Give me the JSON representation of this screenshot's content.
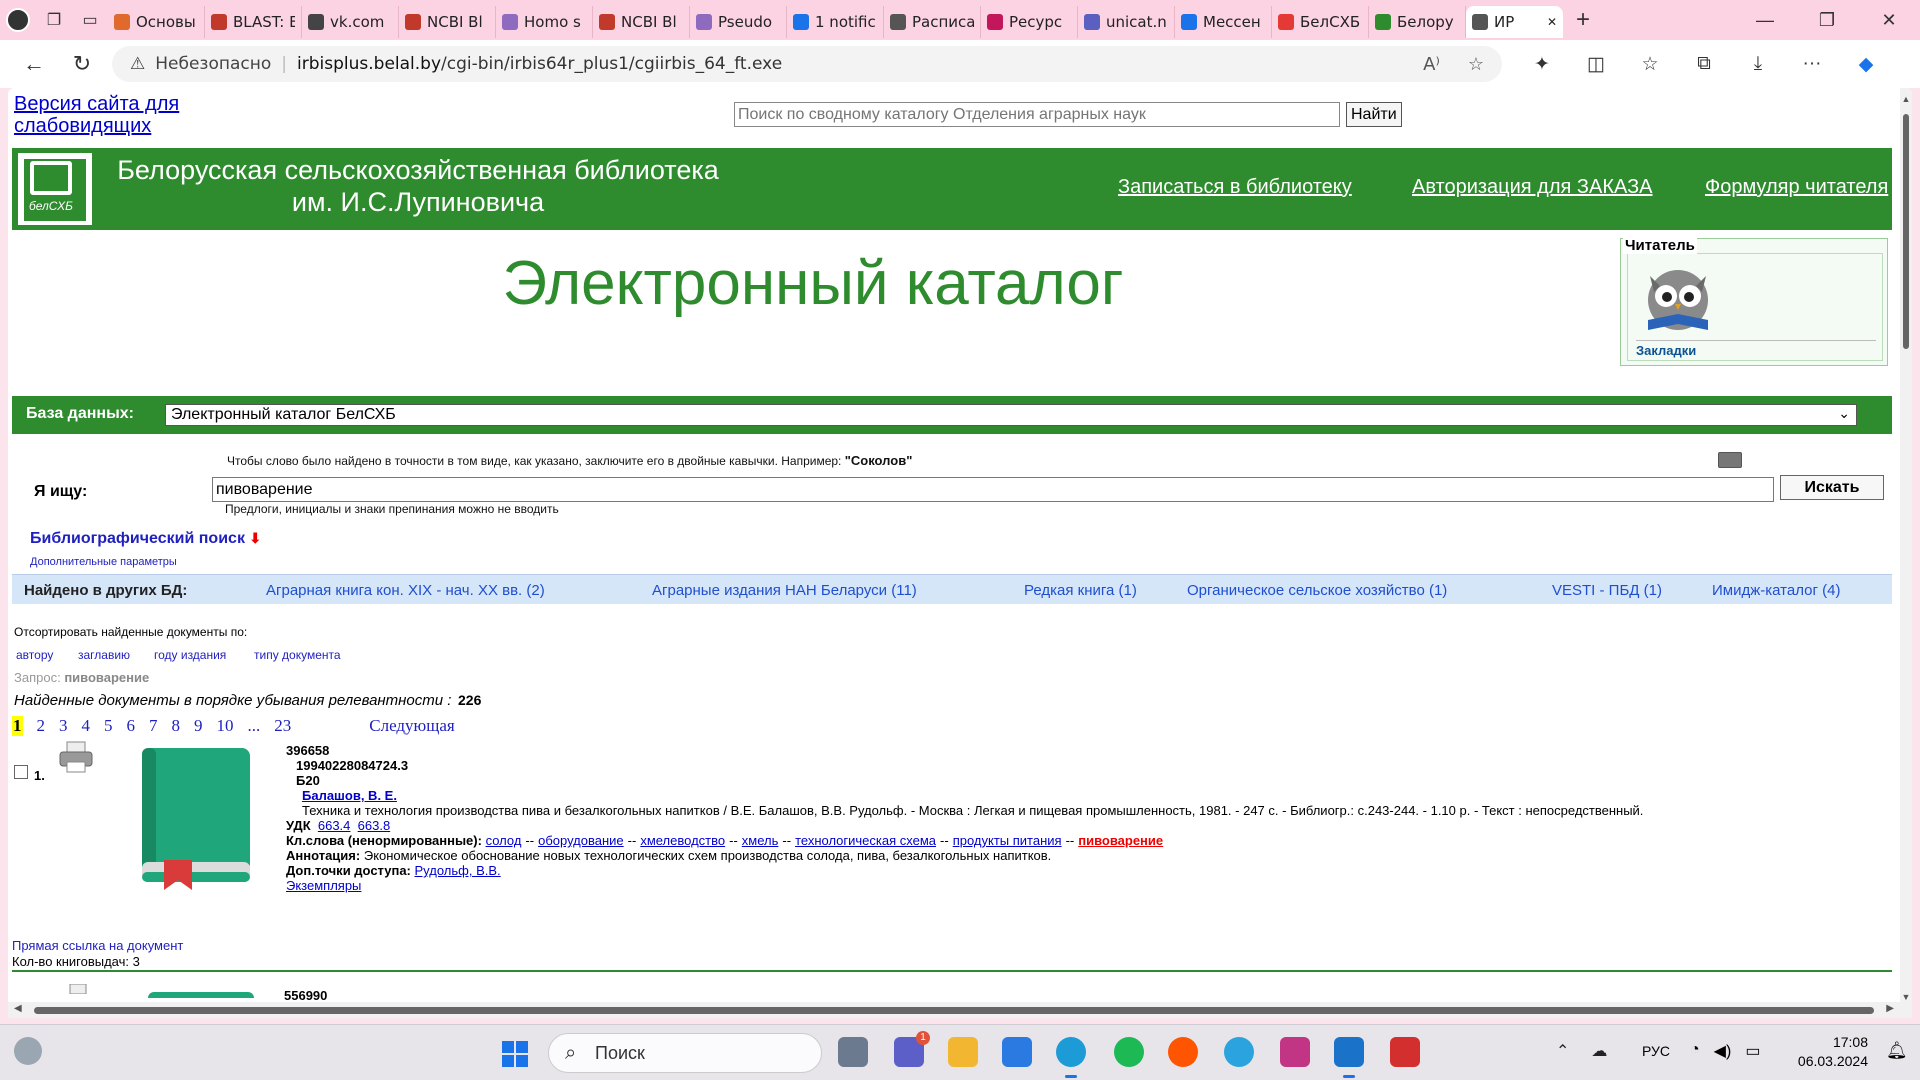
{
  "browser": {
    "tabs": [
      {
        "label": "Основы",
        "color": "#e06a2b"
      },
      {
        "label": "BLAST: E",
        "color": "#c0392b"
      },
      {
        "label": "vk.com",
        "color": "#444444"
      },
      {
        "label": "NCBI Bl",
        "color": "#c0392b"
      },
      {
        "label": "Homo s",
        "color": "#8e6bbf"
      },
      {
        "label": "NCBI Bl",
        "color": "#c0392b"
      },
      {
        "label": "Pseudo",
        "color": "#8e6bbf"
      },
      {
        "label": "1 notific",
        "color": "#1a73e8"
      },
      {
        "label": "Расписа",
        "color": "#555555"
      },
      {
        "label": "Ресурс",
        "color": "#c2185b"
      },
      {
        "label": "unicat.n",
        "color": "#5a5fc0"
      },
      {
        "label": "Мессен",
        "color": "#1a73e8"
      },
      {
        "label": "БелСХБ",
        "color": "#e53935"
      },
      {
        "label": "Белору",
        "color": "#2e8b2e"
      },
      {
        "label": "ИР",
        "color": "#555555"
      }
    ],
    "security": "Небезопасно",
    "url_host": "irbisplus.belal.by",
    "url_path": "/cgi-bin/irbis64r_plus1/cgiirbis_64_ft.exe"
  },
  "page": {
    "accessible_link": "Версия сайта для слабовидящих",
    "top_search_placeholder": "Поиск по сводному каталогу Отделения аграрных наук",
    "top_search_button": "Найти",
    "logo_text": "белСХБ",
    "library_name_line1": "Белорусская сельскохозяйственная библиотека",
    "library_name_line2": "им. И.С.Лупиновича",
    "header_links": [
      "Записаться в библиотеку",
      "Авторизация для ЗАКАЗА",
      "Формуляр читателя"
    ],
    "title": "Электронный каталог",
    "reader_legend": "Читатель",
    "bookmarks": "Закладки",
    "db_label": "База данных:",
    "db_value": "Электронный каталог БелСХБ",
    "hint_quotes": "Чтобы слово было найдено в точности в том виде, как указано, заключите его в двойные кавычки. Например:",
    "hint_example": "\"Соколов\"",
    "i_seek_label": "Я ищу:",
    "query_value": "пивоварение",
    "search_button": "Искать",
    "hint_prepositions": "Предлоги, инициалы и знаки препинания можно не вводить",
    "biblio_search": "Библиографический поиск",
    "extra_params": "Дополнительные параметры",
    "other_db_label": "Найдено в других БД:",
    "other_dbs": [
      "Аграрная книга кон. XIX - нач. XX вв. (2)",
      "Аграрные издания НАН Беларуси (11)",
      "Редкая книга (1)",
      "Органическое сельское хозяйство (1)",
      "VESTI - ПБД (1)",
      "Имидж-каталог (4)"
    ],
    "sort_label": "Отсортировать найденные документы по:",
    "sort_options": [
      "автору",
      "заглавию",
      "году издания",
      "типу документа"
    ],
    "query_label": "Запрос:",
    "query_echo": "пивоварение",
    "found_label": "Найденные документы в порядке убывания релевантности :",
    "found_count": "226",
    "pages": [
      "1",
      "2",
      "3",
      "4",
      "5",
      "6",
      "7",
      "8",
      "9",
      "10",
      "...",
      "23"
    ],
    "next_page": "Следующая",
    "record1": {
      "num": "1.",
      "id": "396658",
      "shelf": "19940228084724.3",
      "code": "Б20",
      "author": "Балашов, В. Е.",
      "description": "Техника и технология производства пива и безалкогольных напитков / В.Е. Балашов, В.В. Рудольф. - Москва : Легкая и пищевая промышленность, 1981. - 247 с. - Библиогр.: с.243-244. - 1.10 р. - Текст : непосредственный.",
      "udk_label": "УДК",
      "udk": [
        "663.4",
        "663.8"
      ],
      "keywords_label": "Кл.слова (ненормированные):",
      "keywords": [
        "солод",
        "оборудование",
        "хмелеводство",
        "хмель",
        "технологическая схема",
        "продукты питания"
      ],
      "keyword_highlight": "пивоварение",
      "keyword_sep": "--",
      "annotation_label": "Аннотация:",
      "annotation": "Экономическое обоснование новых технологических схем производства солода, пива, безалкогольных напитков.",
      "access_label": "Доп.точки доступа:",
      "access": "Рудольф, В.В.",
      "copies": "Экземпляры",
      "direct_link": "Прямая ссылка на документ",
      "loans": "Кол-во книговыдач: 3"
    },
    "record2_id": "556990"
  },
  "taskbar": {
    "search": "Поиск",
    "lang": "РУС",
    "time": "17:08",
    "date": "06.03.2024",
    "chat_badge": "1"
  }
}
